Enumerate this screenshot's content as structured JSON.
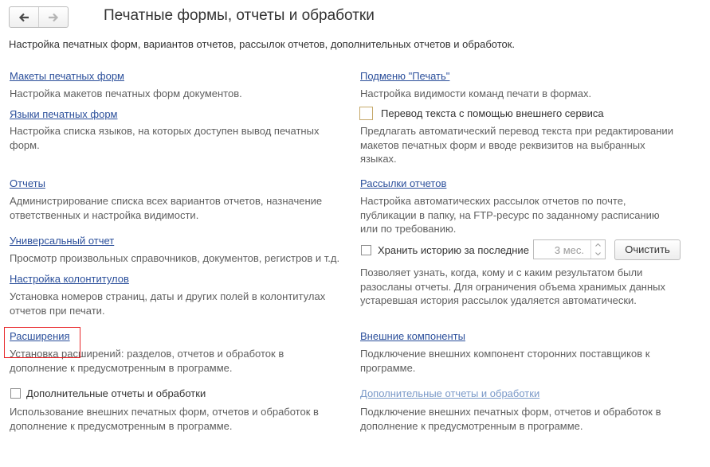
{
  "header": {
    "title": "Печатные формы, отчеты и обработки"
  },
  "subtitle": "Настройка печатных форм, вариантов отчетов, рассылок отчетов, дополнительных отчетов и обработок.",
  "left": {
    "templates": {
      "link": "Макеты печатных форм",
      "desc": "Настройка макетов печатных форм документов."
    },
    "languages": {
      "link": "Языки печатных форм",
      "desc": "Настройка списка языков, на которых доступен вывод печатных форм."
    },
    "reports": {
      "link": "Отчеты",
      "desc": "Администрирование списка всех вариантов отчетов, назначение ответственных и настройка видимости."
    },
    "universal": {
      "link": "Универсальный отчет",
      "desc": "Просмотр произвольных справочников, документов, регистров и т.д."
    },
    "headers": {
      "link": "Настройка колонтитулов",
      "desc": "Установка номеров страниц, даты и других полей в колонтитулах отчетов при печати."
    },
    "extensions": {
      "link": "Расширения",
      "desc": "Установка расширений: разделов, отчетов и обработок в дополнение к предусмотренным в программе."
    },
    "additional": {
      "label": "Дополнительные отчеты и обработки",
      "desc": "Использование внешних печатных форм, отчетов и обработок в дополнение к предусмотренным в программе."
    }
  },
  "right": {
    "print_submenu": {
      "link": "Подменю \"Печать\"",
      "desc": "Настройка видимости команд печати в формах."
    },
    "translation": {
      "label": "Перевод текста с помощью внешнего сервиса",
      "desc": "Предлагать автоматический перевод текста при редактировании макетов печатных форм и вводе реквизитов на выбранных языках."
    },
    "mailings": {
      "link": "Рассылки отчетов",
      "desc": "Настройка автоматических рассылок отчетов по почте, публикации в папку, на FTP-ресурс по заданному расписанию или по требованию."
    },
    "history": {
      "label": "Хранить историю за последние",
      "value": "3 мес.",
      "clear_button": "Очистить",
      "desc": "Позволяет узнать, когда, кому и с каким результатом были разосланы отчеты. Для ограничения объема хранимых данных устаревшая история рассылок удаляется автоматически."
    },
    "components": {
      "link": "Внешние компоненты",
      "desc": "Подключение внешних компонент сторонних поставщиков к программе."
    },
    "additional": {
      "link": "Дополнительные отчеты и обработки",
      "desc": "Подключение внешних печатных форм, отчетов и обработок в дополнение к предусмотренным в программе."
    }
  },
  "icons": {
    "back": "arrow-left-icon",
    "forward": "arrow-right-icon"
  }
}
